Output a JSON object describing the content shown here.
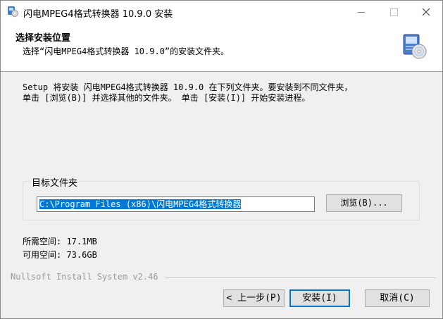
{
  "window": {
    "title": "闪电MPEG4格式转换器 10.9.0 安装"
  },
  "icons": {
    "app": "installer-app-icon",
    "minimize": "minimize-icon",
    "maximize": "maximize-icon",
    "close": "close-icon",
    "header": "install-cd-computer-icon"
  },
  "header": {
    "title": "选择安装位置",
    "subtitle": "选择“闪电MPEG4格式转换器 10.9.0”的安装文件夹。"
  },
  "description": {
    "line1": "Setup 将安装 闪电MPEG4格式转换器 10.9.0 在下列文件夹。要安装到不同文件夹，",
    "line2": "单击 [浏览(B)] 并选择其他的文件夹。 单击 [安装(I)] 开始安装进程。"
  },
  "destination": {
    "legend": "目标文件夹",
    "path_value": "C:\\Program Files (x86)\\闪电MPEG4格式转换器",
    "browse_label": "浏览(B)..."
  },
  "space": {
    "required": "所需空间: 17.1MB",
    "available": "可用空间: 73.6GB"
  },
  "branding": "Nullsoft Install System v2.46",
  "buttons": {
    "back": "< 上一步(P)",
    "install": "安装(I)",
    "cancel": "取消(C)"
  },
  "colors": {
    "selection": "#0078d7",
    "window_bg": "#f0f0f0",
    "header_bg": "#ffffff"
  }
}
